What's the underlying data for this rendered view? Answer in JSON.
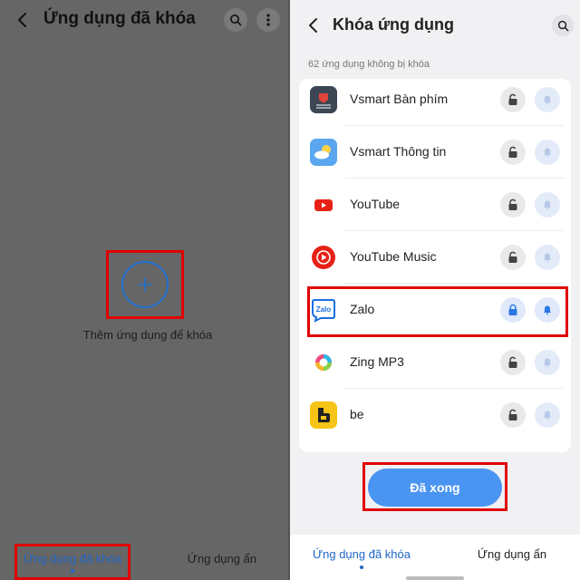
{
  "left_screen": {
    "title": "Ứng dụng đã khóa",
    "add_label": "Thêm ứng dụng để khóa",
    "tabs": [
      {
        "label": "Ứng dụng đã khóa",
        "active": true
      },
      {
        "label": "Ứng dụng ẩn",
        "active": false
      }
    ],
    "icons": [
      "back-icon",
      "search-icon",
      "more-icon",
      "plus-icon"
    ]
  },
  "right_screen": {
    "title": "Khóa ứng dụng",
    "count_text": "62 ứng dụng không bị khóa",
    "apps": [
      {
        "name": "Vsmart Bàn phím",
        "icon": "vsmart-keyboard-icon",
        "locked": false
      },
      {
        "name": "Vsmart Thông tin",
        "icon": "vsmart-weather-icon",
        "locked": false
      },
      {
        "name": "YouTube",
        "icon": "youtube-icon",
        "locked": false
      },
      {
        "name": "YouTube Music",
        "icon": "youtube-music-icon",
        "locked": false
      },
      {
        "name": "Zalo",
        "icon": "zalo-icon",
        "locked": true
      },
      {
        "name": "Zing MP3",
        "icon": "zing-mp3-icon",
        "locked": false
      },
      {
        "name": "be",
        "icon": "be-icon",
        "locked": false
      }
    ],
    "done_label": "Đã xong",
    "tabs": [
      {
        "label": "Ứng dụng đã khóa",
        "active": true
      },
      {
        "label": "Ứng dụng ẩn",
        "active": false
      }
    ]
  },
  "colors": {
    "accent": "#1f66c8",
    "button": "#4a94f2",
    "highlight": "#e00000",
    "overlay": "#666666"
  }
}
